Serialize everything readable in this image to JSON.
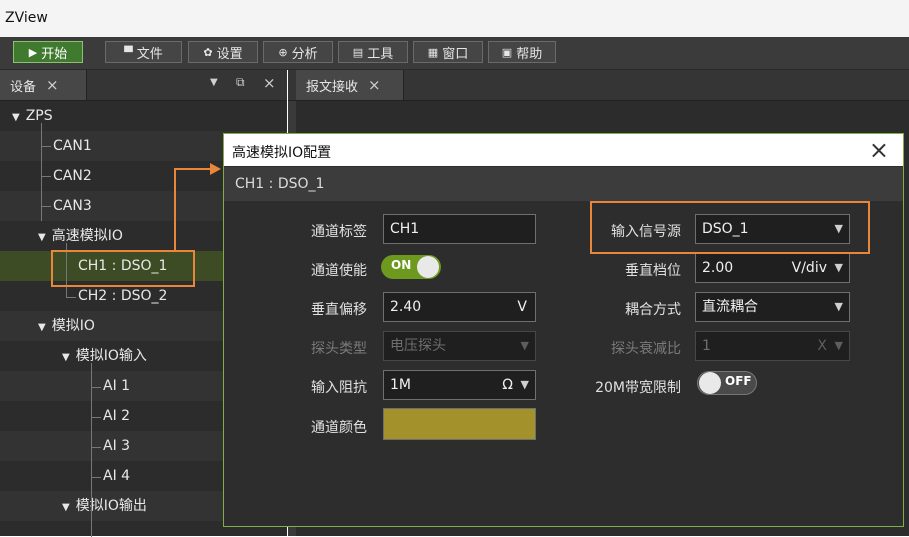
{
  "app": {
    "title": "ZView"
  },
  "toolbar": {
    "start": "开始",
    "file": "文件",
    "settings": "设置",
    "analyze": "分析",
    "tools": "工具",
    "window": "窗口",
    "help": "帮助"
  },
  "left_panel": {
    "tab": "设备"
  },
  "right_panel": {
    "tab": "报文接收"
  },
  "tree": {
    "root": "ZPS",
    "can1": "CAN1",
    "can2": "CAN2",
    "can3": "CAN3",
    "hs_analog": "高速模拟IO",
    "ch1": "CH1 : DSO_1",
    "ch2": "CH2 : DSO_2",
    "analog": "模拟IO",
    "analog_in": "模拟IO输入",
    "ai1": "AI 1",
    "ai2": "AI 2",
    "ai3": "AI 3",
    "ai4": "AI 4",
    "analog_out": "模拟IO输出"
  },
  "dialog": {
    "title": "高速模拟IO配置",
    "subtitle": "CH1 : DSO_1",
    "channel_tag": {
      "label": "通道标签",
      "value": "CH1"
    },
    "channel_enable": {
      "label": "通道使能",
      "state": "ON"
    },
    "vertical_offset": {
      "label": "垂直偏移",
      "value": "2.40",
      "unit": "V"
    },
    "probe_type": {
      "label": "探头类型",
      "value": "电压探头"
    },
    "input_impedance": {
      "label": "输入阻抗",
      "value": "1M",
      "unit": "Ω"
    },
    "channel_color": {
      "label": "通道颜色",
      "color": "#a3922c"
    },
    "input_source": {
      "label": "输入信号源",
      "value": "DSO_1"
    },
    "vertical_scale": {
      "label": "垂直档位",
      "value": "2.00",
      "unit": "V/div"
    },
    "coupling": {
      "label": "耦合方式",
      "value": "直流耦合"
    },
    "probe_attenuation": {
      "label": "探头衰减比",
      "value": "1",
      "unit": "X"
    },
    "bw_limit": {
      "label": "20M带宽限制",
      "state": "OFF"
    }
  },
  "colors": {
    "highlight": "#e8873a",
    "accent_green": "#6d9a1e"
  }
}
